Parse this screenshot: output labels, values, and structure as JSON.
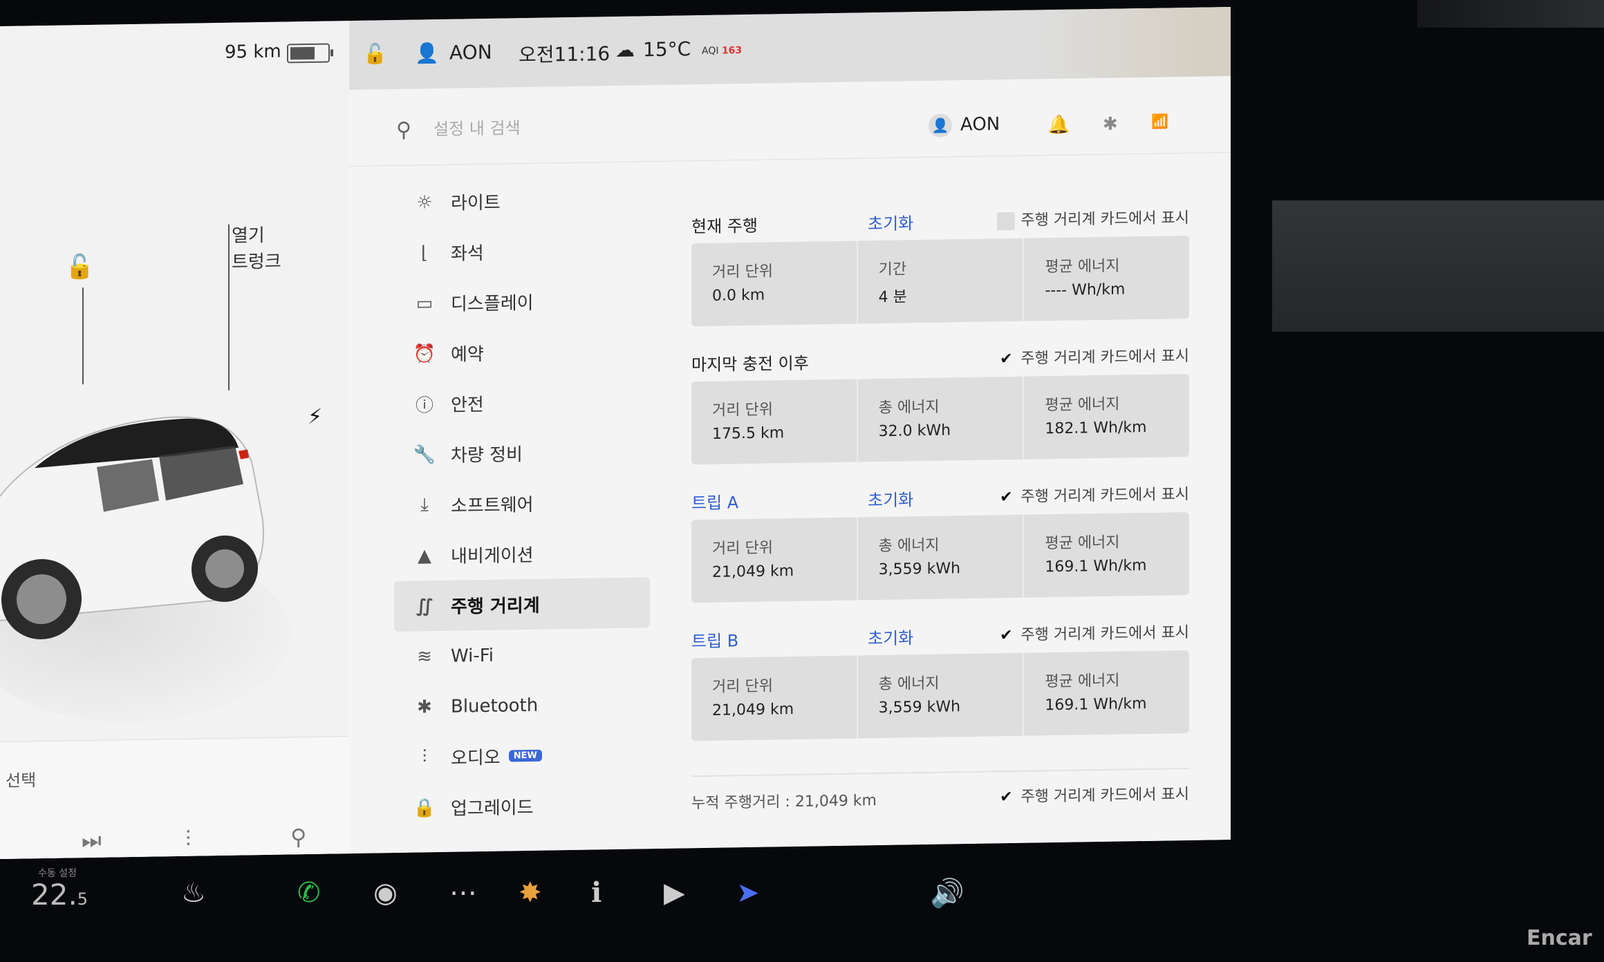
{
  "status": {
    "range": "95 km",
    "battery_level": 0.7,
    "user": "AON",
    "time": "오전11:16",
    "temperature": "15°C",
    "aqi_label": "AQI",
    "aqi_value": "163"
  },
  "car": {
    "trunk_open_label": "열기",
    "trunk_label": "트렁크",
    "media_select": "선택"
  },
  "search": {
    "placeholder": "설정 내 검색"
  },
  "profile": {
    "name": "AON"
  },
  "menu": {
    "items": [
      {
        "label": "라이트",
        "icon": "sun-icon"
      },
      {
        "label": "좌석",
        "icon": "seat-icon"
      },
      {
        "label": "디스플레이",
        "icon": "display-icon"
      },
      {
        "label": "예약",
        "icon": "alarm-icon"
      },
      {
        "label": "안전",
        "icon": "safety-icon"
      },
      {
        "label": "차량 정비",
        "icon": "wrench-icon"
      },
      {
        "label": "소프트웨어",
        "icon": "download-icon"
      },
      {
        "label": "내비게이션",
        "icon": "navigation-icon"
      },
      {
        "label": "주행 거리계",
        "icon": "trip-icon"
      },
      {
        "label": "Wi-Fi",
        "icon": "wifi-icon"
      },
      {
        "label": "Bluetooth",
        "icon": "bluetooth-icon"
      },
      {
        "label": "오디오",
        "icon": "audio-icon",
        "badge": "NEW"
      },
      {
        "label": "업그레이드",
        "icon": "lock-icon"
      }
    ]
  },
  "trips": {
    "current": {
      "title": "현재 주행",
      "reset": "초기화",
      "show_card": "주행 거리계 카드에서 표시",
      "distance_label": "거리 단위",
      "distance": "0.0 km",
      "second_label": "기간",
      "second": "4 분",
      "avg_label": "평균 에너지",
      "avg": "---- Wh/km"
    },
    "since_charge": {
      "title": "마지막 충전 이후",
      "show_card": "주행 거리계 카드에서 표시",
      "distance_label": "거리 단위",
      "distance": "175.5 km",
      "second_label": "총 에너지",
      "second": "32.0 kWh",
      "avg_label": "평균 에너지",
      "avg": "182.1 Wh/km"
    },
    "trip_a": {
      "title": "트립 A",
      "reset": "초기화",
      "show_card": "주행 거리계 카드에서 표시",
      "distance_label": "거리 단위",
      "distance": "21,049 km",
      "second_label": "총 에너지",
      "second": "3,559 kWh",
      "avg_label": "평균 에너지",
      "avg": "169.1 Wh/km"
    },
    "trip_b": {
      "title": "트립 B",
      "reset": "초기화",
      "show_card": "주행 거리계 카드에서 표시",
      "distance_label": "거리 단위",
      "distance": "21,049 km",
      "second_label": "총 에너지",
      "second": "3,559 kWh",
      "avg_label": "평균 에너지",
      "avg": "169.1 Wh/km"
    },
    "odometer": {
      "label": "누적 주행거리 : 21,049 km",
      "show_card": "주행 거리계 카드에서 표시"
    }
  },
  "dock": {
    "temp_mode": "수동 설정",
    "temp_whole": "22.",
    "temp_decimal": "5"
  },
  "watermark": "Encar"
}
